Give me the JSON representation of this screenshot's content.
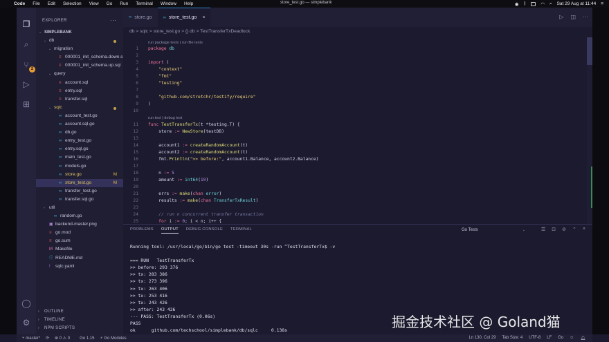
{
  "menubar": {
    "apple": "",
    "items": [
      "Code",
      "File",
      "Edit",
      "Selection",
      "View",
      "Go",
      "Run",
      "Terminal",
      "Window",
      "Help"
    ],
    "window_title": "store_test.go — simplebank",
    "datetime": "Sat 29 Aug at 11:44"
  },
  "sidebar": {
    "title": "EXPLORER",
    "more": "···",
    "tree": [
      {
        "label": "SIMPLEBANK",
        "depth": 0,
        "arrow": "v",
        "kind": "root"
      },
      {
        "label": "db",
        "depth": 1,
        "arrow": "v",
        "kind": "folder",
        "dot": true
      },
      {
        "label": "migration",
        "depth": 2,
        "arrow": "v",
        "kind": "folder"
      },
      {
        "label": "000001_init_schema.down.sql",
        "depth": 3,
        "kind": "sql"
      },
      {
        "label": "000001_init_schema.up.sql",
        "depth": 3,
        "kind": "sql"
      },
      {
        "label": "query",
        "depth": 2,
        "arrow": "v",
        "kind": "folder"
      },
      {
        "label": "account.sql",
        "depth": 3,
        "kind": "sql"
      },
      {
        "label": "entry.sql",
        "depth": 3,
        "kind": "sql"
      },
      {
        "label": "transfer.sql",
        "depth": 3,
        "kind": "sql"
      },
      {
        "label": "sqlc",
        "depth": 2,
        "arrow": "v",
        "kind": "folder",
        "dot": true,
        "yellow": true
      },
      {
        "label": "account_test.go",
        "depth": 3,
        "kind": "go"
      },
      {
        "label": "account.sql.go",
        "depth": 3,
        "kind": "go"
      },
      {
        "label": "db.go",
        "depth": 3,
        "kind": "go"
      },
      {
        "label": "entry_test.go",
        "depth": 3,
        "kind": "go"
      },
      {
        "label": "entry.sql.go",
        "depth": 3,
        "kind": "go"
      },
      {
        "label": "main_test.go",
        "depth": 3,
        "kind": "go"
      },
      {
        "label": "models.go",
        "depth": 3,
        "kind": "go"
      },
      {
        "label": "store.go",
        "depth": 3,
        "kind": "go",
        "mark": "M",
        "yellow": true
      },
      {
        "label": "store_test.go",
        "depth": 3,
        "kind": "go",
        "mark": "M",
        "yellow": true,
        "selected": true
      },
      {
        "label": "transfer_test.go",
        "depth": 3,
        "kind": "go"
      },
      {
        "label": "transfer.sql.go",
        "depth": 3,
        "kind": "go"
      },
      {
        "label": "util",
        "depth": 1,
        "arrow": ">",
        "kind": "folder"
      },
      {
        "label": "random.go",
        "depth": 2,
        "kind": "go"
      },
      {
        "label": "backend-master.png",
        "depth": 1,
        "kind": "png"
      },
      {
        "label": "go.mod",
        "depth": 1,
        "kind": "mod"
      },
      {
        "label": "go.sum",
        "depth": 1,
        "kind": "mod"
      },
      {
        "label": "Makefile",
        "depth": 1,
        "kind": "mk"
      },
      {
        "label": "README.md",
        "depth": 1,
        "kind": "md"
      },
      {
        "label": "sqlc.yaml",
        "depth": 1,
        "kind": "yml"
      }
    ],
    "bottom_sections": [
      "OUTLINE",
      "TIMELINE",
      "NPM SCRIPTS"
    ]
  },
  "editor": {
    "tabs": [
      {
        "label": "store.go",
        "active": false
      },
      {
        "label": "store_test.go",
        "active": true,
        "close": "×"
      }
    ],
    "breadcrumbs": "db > sqlc > store_test.go > {} db > TestTransferTxDeadlock",
    "codelens_top": "run package tests | run file tests",
    "codelens_func": "run test | debug test",
    "lines": [
      {
        "n": "1",
        "html": "<span class='k'>package</span> <span class='t'>db</span>"
      },
      {
        "n": "2",
        "html": ""
      },
      {
        "n": "3",
        "html": "<span class='k'>import</span> <span class='p'>(</span>"
      },
      {
        "n": "4",
        "html": "    <span class='s'>\"context\"</span>"
      },
      {
        "n": "5",
        "html": "    <span class='s'>\"fmt\"</span>"
      },
      {
        "n": "6",
        "html": "    <span class='s'>\"testing\"</span>"
      },
      {
        "n": "7",
        "html": ""
      },
      {
        "n": "8",
        "html": "    <span class='s'>\"github.com/stretchr/testify/require\"</span>"
      },
      {
        "n": "9",
        "html": "<span class='p'>)</span>"
      },
      {
        "n": "10",
        "html": ""
      },
      {
        "n": "11",
        "html": "<span class='k'>func</span> <span class='f'>TestTransferTx</span><span class='p'>(t *testing.T) {</span>"
      },
      {
        "n": "12",
        "html": "    <span class='v'>store</span> <span class='k'>:=</span> <span class='f'>NewStore</span><span class='p'>(testDB)</span>"
      },
      {
        "n": "13",
        "html": ""
      },
      {
        "n": "14",
        "html": "    <span class='v'>account1</span> <span class='k'>:=</span> <span class='f'>createRandomAccount</span><span class='p'>(t)</span>"
      },
      {
        "n": "15",
        "html": "    <span class='v'>account2</span> <span class='k'>:=</span> <span class='f'>createRandomAccount</span><span class='p'>(t)</span>"
      },
      {
        "n": "16",
        "html": "    <span class='v'>fmt.</span><span class='f'>Println</span><span class='p'>(</span><span class='s'>\">> before:\"</span><span class='p'>, account1.Balance, account2.Balance)</span>"
      },
      {
        "n": "17",
        "html": ""
      },
      {
        "n": "18",
        "html": "    <span class='v'>n</span> <span class='k'>:=</span> <span class='n'>5</span>"
      },
      {
        "n": "19",
        "html": "    <span class='v'>amount</span> <span class='k'>:=</span> <span class='t'>int64</span><span class='p'>(</span><span class='n'>10</span><span class='p'>)</span>"
      },
      {
        "n": "20",
        "html": ""
      },
      {
        "n": "21",
        "html": "    <span class='v'>errs</span> <span class='k'>:=</span> <span class='f'>make</span><span class='p'>(</span><span class='k'>chan</span> <span class='t'>error</span><span class='p'>)</span>"
      },
      {
        "n": "22",
        "html": "    <span class='v'>results</span> <span class='k'>:=</span> <span class='f'>make</span><span class='p'>(</span><span class='k'>chan</span> <span class='t'>TransferTxResult</span><span class='p'>)</span>"
      },
      {
        "n": "23",
        "html": ""
      },
      {
        "n": "24",
        "html": "    <span class='c'>// run n concurrent transfer transaction</span>"
      },
      {
        "n": "25",
        "html": "    <span class='k'>for</span> <span class='v'>i</span> <span class='k'>:=</span> <span class='n'>0</span><span class='p'>; i &lt; n; i++ {</span>"
      }
    ]
  },
  "panel": {
    "tabs": [
      "PROBLEMS",
      "OUTPUT",
      "DEBUG CONSOLE",
      "TERMINAL"
    ],
    "active_tab": "OUTPUT",
    "output_channel": "Go Tests",
    "output": [
      "Running tool: /usr/local/go/bin/go test -timeout 30s -run ^TestTransferTx$ -v",
      "",
      "=== RUN   TestTransferTx",
      ">> before: 293 376",
      ">> tx: 283 386",
      ">> tx: 273 396",
      ">> tx: 263 406",
      ">> tx: 253 416",
      ">> tx: 243 426",
      ">> after: 243 426",
      "--- PASS: TestTransferTx (0.06s)",
      "PASS",
      "ok      github.com/techschool/simplebank/db/sqlc     0.138s"
    ]
  },
  "statusbar": {
    "branch": "master*",
    "sync": "⟳",
    "problems": "⊗ 0 ⚠ 0",
    "go_version": "Go 1.15",
    "go_modules": "⚡ Go Modules",
    "cursor": "Ln 130, Col 29",
    "tab_size": "Tab Size: 4",
    "encoding": "UTF-8",
    "eol": "LF",
    "language": "Go"
  },
  "watermark": "掘金技术社区 @ Goland猫",
  "colors": {
    "accent": "#2d86c9",
    "modified": "#e2b347",
    "badge": "#e59b31"
  }
}
